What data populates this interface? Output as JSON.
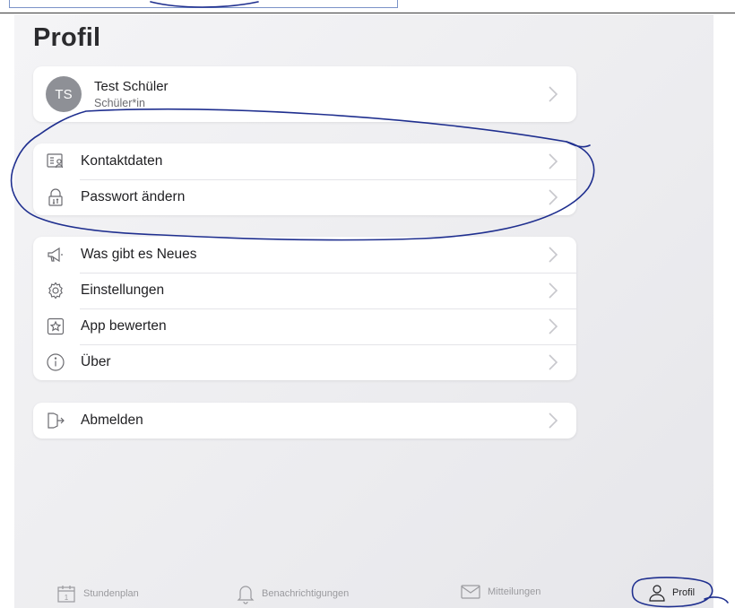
{
  "page": {
    "title": "Profil"
  },
  "profile": {
    "initials": "TS",
    "name": "Test Schüler",
    "role": "Schüler*in"
  },
  "groups": [
    {
      "items": [
        {
          "label": "Kontaktdaten",
          "icon": "contact-card-icon"
        },
        {
          "label": "Passwort ändern",
          "icon": "lock-icon"
        }
      ]
    },
    {
      "items": [
        {
          "label": "Was gibt es Neues",
          "icon": "megaphone-icon"
        },
        {
          "label": "Einstellungen",
          "icon": "gear-icon"
        },
        {
          "label": "App bewerten",
          "icon": "star-icon"
        },
        {
          "label": "Über",
          "icon": "info-icon"
        }
      ]
    },
    {
      "items": [
        {
          "label": "Abmelden",
          "icon": "logout-icon"
        }
      ]
    }
  ],
  "tabbar": {
    "tabs": [
      {
        "label": "Stundenplan",
        "icon": "calendar-icon",
        "badge": "1"
      },
      {
        "label": "Benachrichtigungen",
        "icon": "bell-icon"
      },
      {
        "label": "Mitteilungen",
        "icon": "envelope-icon"
      },
      {
        "label": "Profil",
        "icon": "person-icon",
        "active": true
      }
    ]
  },
  "colors": {
    "background": "#ececef",
    "card": "#ffffff",
    "avatar": "#8e9096",
    "annotation_ink": "#1f2f8f",
    "inactive": "#9a9a9e"
  }
}
